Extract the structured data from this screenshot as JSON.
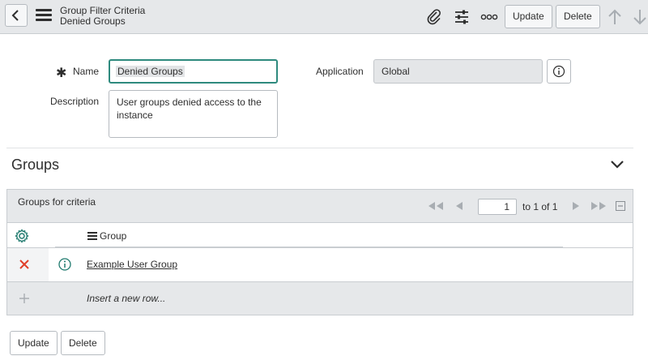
{
  "header": {
    "title": "Group Filter Criteria",
    "subtitle": "Denied Groups",
    "update_label": "Update",
    "delete_label": "Delete",
    "icons": [
      "back-icon",
      "menu-icon",
      "paperclip-icon",
      "settings-sliders-icon",
      "more-icon",
      "arrow-up-icon",
      "arrow-down-icon"
    ]
  },
  "form": {
    "name_label": "Name",
    "name_value": "Denied Groups",
    "description_label": "Description",
    "description_value": "User groups denied access to the instance",
    "application_label": "Application",
    "application_value": "Global"
  },
  "section": {
    "title": "Groups"
  },
  "related_list": {
    "title": "Groups for criteria",
    "page_value": "1",
    "page_text": "to 1 of 1",
    "column_header": "Group",
    "rows": [
      {
        "group": "Example User Group"
      }
    ],
    "insert_text": "Insert a new row..."
  },
  "bottom": {
    "update_label": "Update",
    "delete_label": "Delete"
  },
  "colors": {
    "header_bg": "#e6e8ea",
    "focus_border": "#2e8a7e",
    "delete_x": "#e0402a",
    "accent_green": "#1f7a6e"
  }
}
